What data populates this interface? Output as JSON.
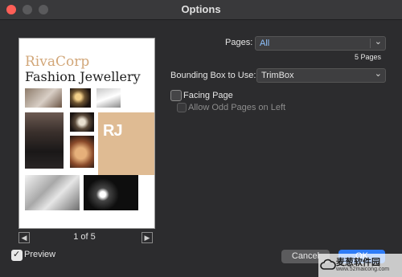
{
  "window": {
    "title": "Options"
  },
  "preview": {
    "brand_line1": "RivaCorp",
    "brand_line2": "Fashion Jewellery",
    "logo_text": "RJ",
    "page_indicator": "1 of 5",
    "preview_label": "Preview",
    "preview_checked": true
  },
  "options": {
    "pages_label": "Pages:",
    "pages_value": "All",
    "pages_count": "5 Pages",
    "bbox_label": "Bounding Box to Use:",
    "bbox_value": "TrimBox",
    "facing_label": "Facing Page",
    "odd_left_label": "Allow Odd Pages on Left"
  },
  "buttons": {
    "cancel": "Cancel",
    "ok": "OK"
  },
  "watermark": {
    "text": "麦葱软件园",
    "url": "www.52maicong.com"
  },
  "colors": {
    "accent": "#2f7cf6",
    "tan": "#dfbb93",
    "brand": "#d2a779"
  }
}
